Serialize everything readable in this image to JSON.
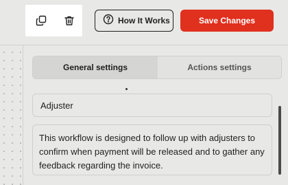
{
  "toolbar": {
    "how_it_works_label": "How It Works",
    "save_label": "Save Changes",
    "icons": [
      "copy-icon",
      "trash-icon",
      "help-circle-icon"
    ],
    "save_color": "#e0301e"
  },
  "tabs": [
    {
      "label": "General settings",
      "active": true
    },
    {
      "label": "Actions settings",
      "active": false
    }
  ],
  "form": {
    "name_value": "Adjuster",
    "description_value": "This workflow is designed to follow up with adjusters to confirm when payment will be released and to gather any feedback regarding the invoice."
  }
}
